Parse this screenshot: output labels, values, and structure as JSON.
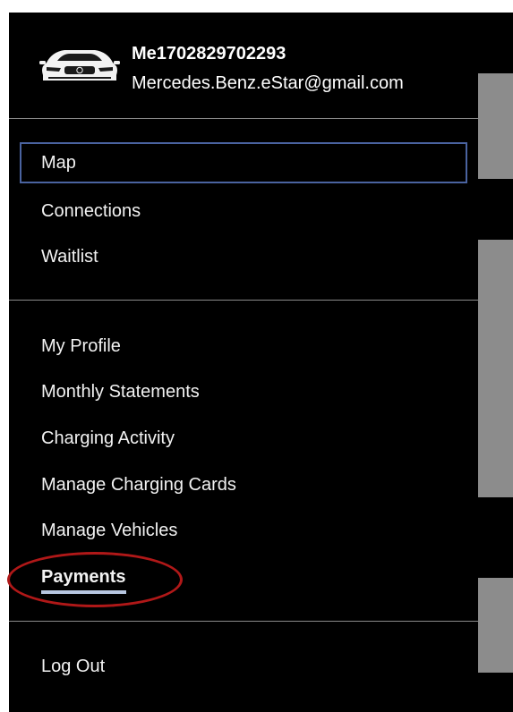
{
  "header": {
    "user_name": "Me1702829702293",
    "user_email": "Mercedes.Benz.eStar@gmail.com",
    "car_icon": "car-icon"
  },
  "menu": {
    "section_1": [
      {
        "label": "Map",
        "selected": true
      },
      {
        "label": "Connections"
      },
      {
        "label": "Waitlist"
      }
    ],
    "section_2": [
      {
        "label": "My Profile"
      },
      {
        "label": "Monthly Statements"
      },
      {
        "label": "Charging Activity"
      },
      {
        "label": "Manage Charging Cards"
      },
      {
        "label": "Manage Vehicles"
      },
      {
        "label": "Payments",
        "annotated": true
      }
    ],
    "section_3": [
      {
        "label": "Log Out"
      }
    ]
  },
  "colors": {
    "drawer_bg": "#000000",
    "selected_border": "#4a63a0",
    "annotation": "#b01818",
    "underline": "#b7c6e0"
  }
}
